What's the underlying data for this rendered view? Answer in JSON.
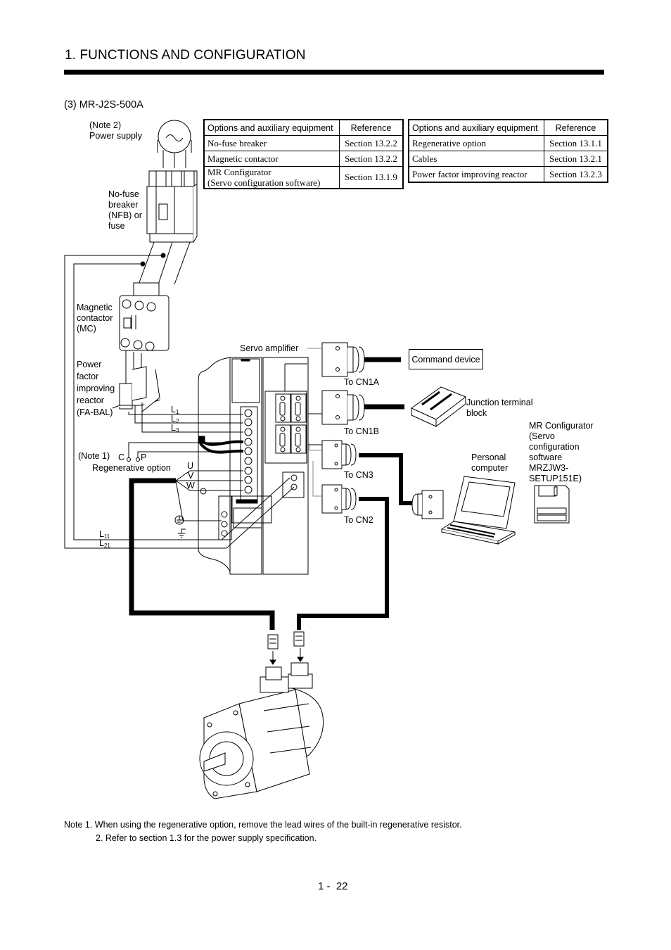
{
  "header": {
    "title": "1. FUNCTIONS AND CONFIGURATION"
  },
  "section": {
    "title": "(3) MR-J2S-500A"
  },
  "tables": {
    "left": {
      "headers": [
        "Options and auxiliary equipment",
        "Reference"
      ],
      "rows": [
        {
          "item": "No-fuse breaker",
          "ref": "Section 13.2.2"
        },
        {
          "item": "Magnetic contactor",
          "ref": "Section 13.2.2"
        },
        {
          "item_line1": "MR Configurator",
          "item_line2": "(Servo configuration software)",
          "ref": "Section 13.1.9"
        }
      ]
    },
    "right": {
      "headers": [
        "Options and auxiliary equipment",
        "Reference"
      ],
      "rows": [
        {
          "item": "Regenerative option",
          "ref": "Section 13.1.1"
        },
        {
          "item": "Cables",
          "ref": "Section 13.2.1"
        },
        {
          "item": "Power factor improving reactor",
          "ref": "Section 13.2.3"
        }
      ]
    }
  },
  "diagram": {
    "labels": {
      "power_supply_note": "(Note 2)",
      "power_supply": "Power supply",
      "nfb": [
        "No-fuse",
        "breaker",
        "(NFB) or",
        "fuse"
      ],
      "mc": [
        "Magnetic",
        "contactor",
        "(MC)"
      ],
      "reactor": [
        "Power",
        "factor",
        "improving",
        "reactor",
        "(FA-BAL)"
      ],
      "servo_amplifier": "Servo amplifier",
      "regen_note": "(Note 1)",
      "regen_c": "C",
      "regen_p": "P",
      "regen_option": "Regenerative option",
      "phase_u": "U",
      "phase_v": "V",
      "phase_w": "W",
      "line_l": "L",
      "l1_sub": "1",
      "l2_sub": "2",
      "l3_sub": "3",
      "l11_sub": "11",
      "l21_sub": "21",
      "to_cn1a": "To CN1A",
      "to_cn1b": "To CN1B",
      "to_cn3": "To CN3",
      "to_cn2": "To CN2",
      "command_device": "Command device",
      "junction_block": [
        "Junction terminal",
        "block"
      ],
      "personal_computer": [
        "Personal",
        "computer"
      ],
      "mr_configurator": [
        "MR Configurator",
        "(Servo",
        "configuration",
        "software",
        "MRZJW3-",
        "SETUP151E)"
      ]
    },
    "icons": [
      "ac-source-icon",
      "breaker-icon",
      "contactor-icon",
      "reactor-icon",
      "servo-amplifier-icon",
      "ground-icon",
      "connector-icon",
      "terminal-block-icon",
      "laptop-icon",
      "floppy-disk-icon",
      "servo-motor-icon"
    ]
  },
  "notes": {
    "note1": "Note 1. When using the regenerative option, remove the lead wires of the built-in regenerative resistor.",
    "note2": "2. Refer to section 1.3 for the power supply specification."
  },
  "footer": {
    "page_number": "1 -  22"
  }
}
